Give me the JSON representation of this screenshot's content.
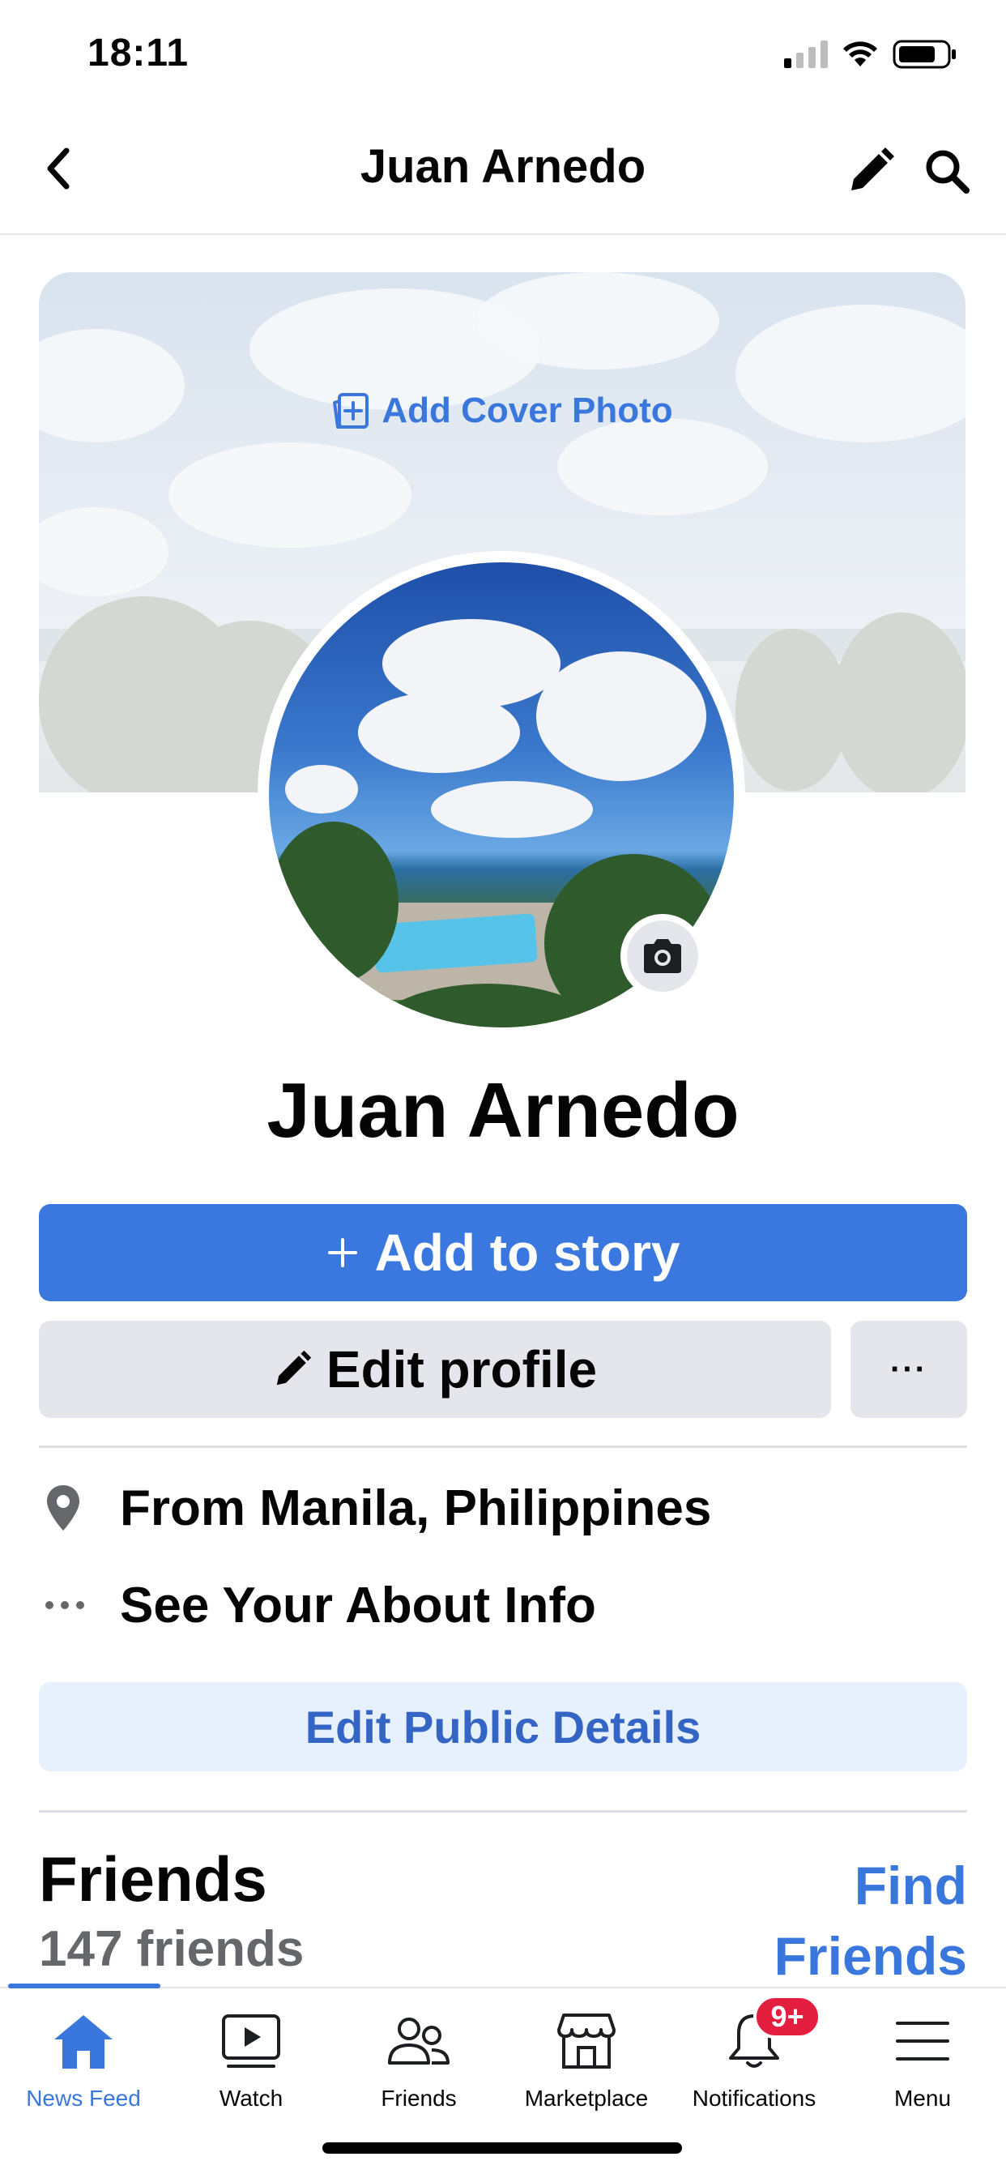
{
  "status_bar": {
    "time": "18:11"
  },
  "header": {
    "title": "Juan Arnedo"
  },
  "cover": {
    "add_cover_label": "Add Cover Photo"
  },
  "profile": {
    "name": "Juan Arnedo"
  },
  "actions": {
    "add_story_label": "Add to story",
    "edit_profile_label": "Edit profile",
    "more_label": "···"
  },
  "about": {
    "items": [
      {
        "icon": "location-pin-icon",
        "text": "From Manila, Philippines"
      },
      {
        "icon": "more-dots-icon",
        "text": "See Your About Info"
      }
    ],
    "edit_public_details_label": "Edit Public Details"
  },
  "friends": {
    "title": "Friends",
    "count": "147 friends",
    "find_friends_label": "Find Friends"
  },
  "bottom_nav": {
    "items": [
      {
        "label": "News Feed",
        "icon": "home-icon",
        "active": true
      },
      {
        "label": "Watch",
        "icon": "watch-icon",
        "active": false
      },
      {
        "label": "Friends",
        "icon": "friends-icon",
        "active": false
      },
      {
        "label": "Marketplace",
        "icon": "marketplace-icon",
        "active": false
      },
      {
        "label": "Notifications",
        "icon": "bell-icon",
        "active": false,
        "badge": "9+"
      },
      {
        "label": "Menu",
        "icon": "hamburger-menu-icon",
        "active": false
      }
    ]
  },
  "colors": {
    "accent": "#3a78e0",
    "link_blue": "#3a77dd",
    "secondary_button": "#e4e6eb",
    "light_blue_button": "#e7f0fd",
    "badge_red": "#e41e3f",
    "muted_text": "#65676b"
  }
}
